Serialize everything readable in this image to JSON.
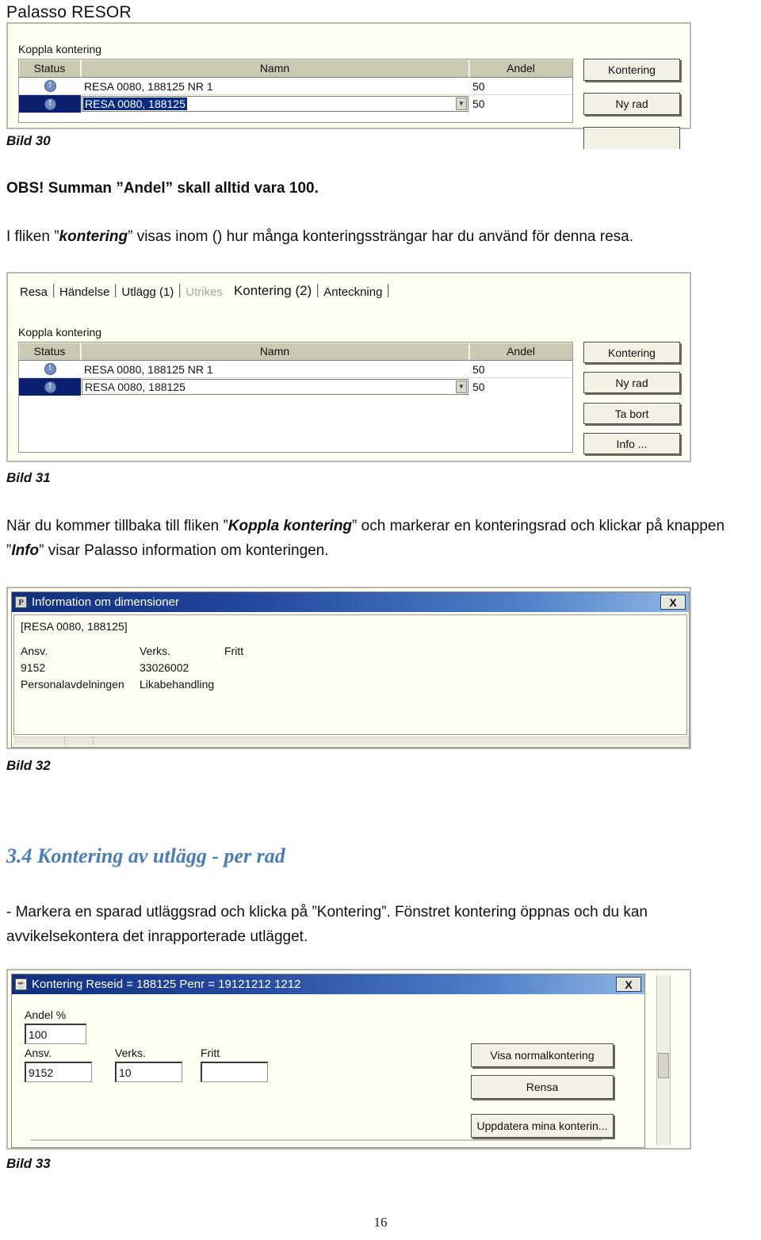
{
  "document": {
    "title": "Palasso RESOR",
    "page_number": "16"
  },
  "paragraphs": {
    "obs": {
      "lead": "OBS! Summan ",
      "quoted": "”Andel”",
      "rest": " skall alltid vara 100."
    },
    "flik_kontering": {
      "before": "I fliken ”",
      "emph": "kontering",
      "after": "” visas inom () hur många konteringssträngar har du använd för denna resa."
    },
    "info_knapp": {
      "part1": "När du kommer tillbaka till fliken ”",
      "emph1": "Koppla kontering",
      "part2": "” och markerar en konteringsrad och klickar på knappen ”",
      "emph2": "Info",
      "part3": "” visar Palasso information om konteringen."
    },
    "per_rad": "- Markera en sparad utläggsrad och klicka på ”Kontering”. Fönstret kontering öppnas och du kan avvikelsekontera det inrapporterade utlägget."
  },
  "headings": {
    "section_3_4": "3.4 Kontering av utlägg - per rad"
  },
  "captions": {
    "bild30": "Bild 30",
    "bild31": "Bild 31",
    "bild32": "Bild 32",
    "bild33": "Bild 33"
  },
  "shot30": {
    "group_label": "Koppla kontering",
    "columns": [
      "Status",
      "Namn",
      "Andel"
    ],
    "rows": [
      {
        "status": "!",
        "namn": "RESA 0080, 188125 NR 1",
        "andel": "50",
        "selected": false
      },
      {
        "status": "!",
        "namn": "RESA 0080, 188125",
        "andel": "50",
        "selected": true
      }
    ],
    "buttons": [
      "Kontering",
      "Ny rad"
    ]
  },
  "shot31": {
    "tabs": [
      {
        "label": "Resa",
        "state": "normal"
      },
      {
        "label": "Händelse",
        "state": "normal"
      },
      {
        "label": "Utlägg (1)",
        "state": "normal"
      },
      {
        "label": "Utrikes",
        "state": "disabled"
      },
      {
        "label": "Kontering (2)",
        "state": "active"
      },
      {
        "label": "Anteckning",
        "state": "normal"
      }
    ],
    "group_label": "Koppla kontering",
    "columns": [
      "Status",
      "Namn",
      "Andel"
    ],
    "rows": [
      {
        "status": "!",
        "namn": "RESA 0080, 188125 NR 1",
        "andel": "50",
        "selected": false
      },
      {
        "status": "!",
        "namn": "RESA 0080, 188125",
        "andel": "50",
        "selected": true
      }
    ],
    "buttons": [
      "Kontering",
      "Ny rad",
      "Ta bort",
      "Info ..."
    ]
  },
  "shot32": {
    "window_title": "Information om dimensioner",
    "app_icon": "palasso-p-icon",
    "close_label": "X",
    "context": "[RESA 0080, 188125]",
    "table": {
      "headers": [
        "Ansv.",
        "Verks.",
        "Fritt"
      ],
      "rows": [
        [
          "9152",
          "33026002",
          ""
        ],
        [
          "Personalavdelningen",
          "Likabehandling",
          ""
        ]
      ]
    }
  },
  "shot33": {
    "window_title": "Kontering Reseid = 188125 Penr = 19121212 1212",
    "app_icon": "java-cup-icon",
    "close_label": "X",
    "fields": [
      {
        "label": "Andel %",
        "value": "100"
      },
      {
        "label": "Ansv.",
        "value": "9152"
      },
      {
        "label": "Verks.",
        "value": "10"
      },
      {
        "label": "Fritt",
        "value": ""
      }
    ],
    "buttons": [
      "Visa normalkontering",
      "Rensa",
      "Uppdatera mina konterin..."
    ]
  },
  "colors": {
    "heading_blue": "#4a7cb5",
    "table_header": "#cac9b1",
    "selection_navy": "#0b1f6e",
    "titlebar_blue": "#10307e",
    "window_bg": "#fffef2"
  }
}
